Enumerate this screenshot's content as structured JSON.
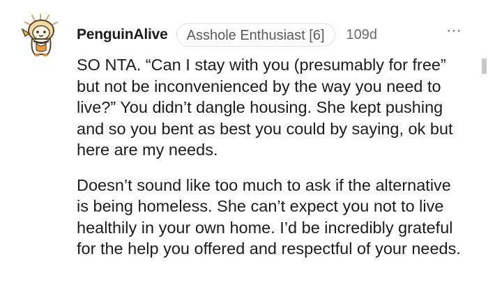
{
  "comment": {
    "username": "PenguinAlive",
    "flair": "Asshole Enthusiast [6]",
    "timestamp": "109d",
    "more_icon": "⋯",
    "paragraphs": [
      "SO NTA. “Can I stay with you (presumably for free” but not be inconvenienced by the way you need to live?” You didn’t dangle housing. She kept pushing and so you bent as best you could by saying, ok but here are my needs.",
      "Doesn’t sound like too much to ask if the alternative is being homeless. She can’t expect you not to live healthily in your own home. I’d be incredibly grateful for the help you offered and respectful of your needs."
    ],
    "avatar_icon": "penguin-avatar-icon",
    "colors": {
      "text": "#1c1c1c",
      "meta": "#6a6a6a",
      "flair_border": "#e1e1e1"
    }
  }
}
